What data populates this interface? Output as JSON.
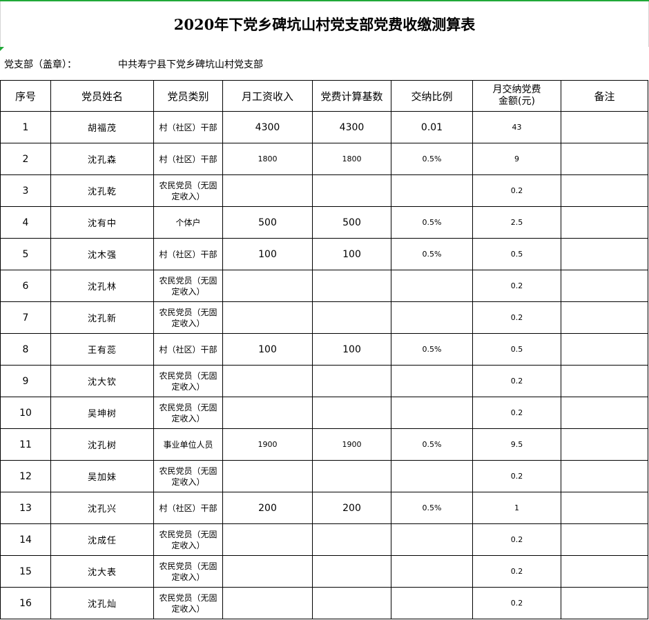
{
  "title": "2020年下党乡碑坑山村党支部党费收缴测算表",
  "org": {
    "label": "党支部（盖章）：",
    "value": "中共寿宁县下党乡碑坑山村党支部"
  },
  "headers": [
    "序号",
    "党员姓名",
    "党员类别",
    "月工资收入",
    "党费计算基数",
    "交纳比例",
    "月交纳党费金额(元)",
    "备注"
  ],
  "header_amount_lines": [
    "月交纳党费",
    "金额(元)"
  ],
  "rows": [
    {
      "no": "1",
      "name": "胡福茂",
      "type": "村（社区）干部",
      "income": "4300",
      "base": "4300",
      "ratio": "0.01",
      "amount": "43",
      "note": ""
    },
    {
      "no": "2",
      "name": "沈孔森",
      "type": "村（社区）干部",
      "income": "1800",
      "base": "1800",
      "ratio": "0.5%",
      "amount": "9",
      "note": ""
    },
    {
      "no": "3",
      "name": "沈孔乾",
      "type": "农民党员（无固定收入）",
      "income": "",
      "base": "",
      "ratio": "",
      "amount": "0.2",
      "note": ""
    },
    {
      "no": "4",
      "name": "沈有中",
      "type": "个体户",
      "income": "500",
      "base": "500",
      "ratio": "0.5%",
      "amount": "2.5",
      "note": ""
    },
    {
      "no": "5",
      "name": "沈木强",
      "type": "村（社区）干部",
      "income": "100",
      "base": "100",
      "ratio": "0.5%",
      "amount": "0.5",
      "note": ""
    },
    {
      "no": "6",
      "name": "沈孔林",
      "type": "农民党员（无固定收入）",
      "income": "",
      "base": "",
      "ratio": "",
      "amount": "0.2",
      "note": ""
    },
    {
      "no": "7",
      "name": "沈孔新",
      "type": "农民党员（无固定收入）",
      "income": "",
      "base": "",
      "ratio": "",
      "amount": "0.2",
      "note": ""
    },
    {
      "no": "8",
      "name": "王有蕊",
      "type": "村（社区）干部",
      "income": "100",
      "base": "100",
      "ratio": "0.5%",
      "amount": "0.5",
      "note": ""
    },
    {
      "no": "9",
      "name": "沈大钦",
      "type": "农民党员（无固定收入）",
      "income": "",
      "base": "",
      "ratio": "",
      "amount": "0.2",
      "note": ""
    },
    {
      "no": "10",
      "name": "吴坤树",
      "type": "农民党员（无固定收入）",
      "income": "",
      "base": "",
      "ratio": "",
      "amount": "0.2",
      "note": ""
    },
    {
      "no": "11",
      "name": "沈孔树",
      "type": "事业单位人员",
      "income": "1900",
      "base": "1900",
      "ratio": "0.5%",
      "amount": "9.5",
      "note": ""
    },
    {
      "no": "12",
      "name": "吴加妹",
      "type": "农民党员（无固定收入）",
      "income": "",
      "base": "",
      "ratio": "",
      "amount": "0.2",
      "note": ""
    },
    {
      "no": "13",
      "name": "沈孔兴",
      "type": "村（社区）干部",
      "income": "200",
      "base": "200",
      "ratio": "0.5%",
      "amount": "1",
      "note": ""
    },
    {
      "no": "14",
      "name": "沈成任",
      "type": "农民党员（无固定收入）",
      "income": "",
      "base": "",
      "ratio": "",
      "amount": "0.2",
      "note": ""
    },
    {
      "no": "15",
      "name": "沈大表",
      "type": "农民党员（无固定收入）",
      "income": "",
      "base": "",
      "ratio": "",
      "amount": "0.2",
      "note": ""
    },
    {
      "no": "16",
      "name": "沈孔灿",
      "type": "农民党员（无固定收入）",
      "income": "",
      "base": "",
      "ratio": "",
      "amount": "0.2",
      "note": ""
    }
  ]
}
